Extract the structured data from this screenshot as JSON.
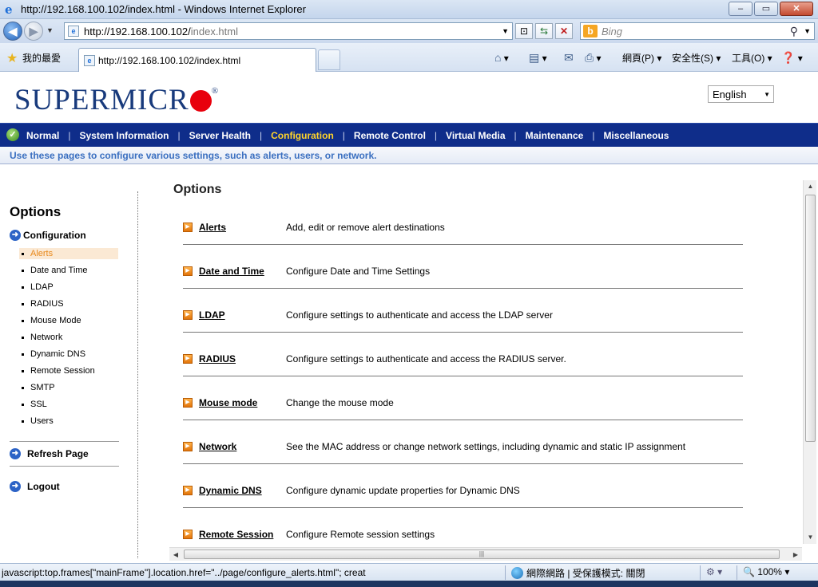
{
  "browser": {
    "title": "http://192.168.100.102/index.html - Windows Internet Explorer",
    "address_host": "http://192.168.100.102/",
    "address_path": "index.html",
    "search_placeholder": "Bing",
    "favorites_label": "我的最愛",
    "tab_title": "http://192.168.100.102/index.html",
    "commands": {
      "page": "網頁(P)",
      "safety": "安全性(S)",
      "tools": "工具(O)"
    },
    "window_buttons": {
      "minimize": "–",
      "maximize": "▭",
      "close": "✕"
    }
  },
  "header": {
    "logo_text": "SUPERMICR",
    "language": "English"
  },
  "nav": {
    "items": [
      {
        "label": "Normal"
      },
      {
        "label": "System Information"
      },
      {
        "label": "Server Health"
      },
      {
        "label": "Configuration",
        "active": true
      },
      {
        "label": "Remote Control"
      },
      {
        "label": "Virtual Media"
      },
      {
        "label": "Maintenance"
      },
      {
        "label": "Miscellaneous"
      }
    ],
    "subtitle": "Use these pages to configure various settings, such as alerts, users, or network."
  },
  "sidebar": {
    "title": "Options",
    "section": "Configuration",
    "items": [
      "Alerts",
      "Date and Time",
      "LDAP",
      "RADIUS",
      "Mouse Mode",
      "Network",
      "Dynamic DNS",
      "Remote Session",
      "SMTP",
      "SSL",
      "Users"
    ],
    "active_index": 0,
    "refresh": "Refresh Page",
    "logout": "Logout"
  },
  "main": {
    "title": "Options",
    "options": [
      {
        "name": "Alerts",
        "desc": "Add, edit or remove alert destinations"
      },
      {
        "name": "Date and Time",
        "desc": "Configure Date and Time Settings"
      },
      {
        "name": "LDAP",
        "desc": "Configure settings to authenticate and access the LDAP server"
      },
      {
        "name": "RADIUS",
        "desc": "Configure settings to authenticate and access the RADIUS server."
      },
      {
        "name": "Mouse mode",
        "desc": "Change the mouse mode"
      },
      {
        "name": "Network",
        "desc": "See the MAC address or change network settings, including dynamic and static IP assignment"
      },
      {
        "name": "Dynamic DNS",
        "desc": "Configure dynamic update properties for Dynamic DNS"
      },
      {
        "name": "Remote Session",
        "desc": "Configure Remote session settings"
      }
    ]
  },
  "status": {
    "text": "javascript:top.frames[\"mainFrame\"].location.href=\"../page/configure_alerts.html\"; creat",
    "zone": "網際網路 | 受保護模式: 關閉",
    "zoom": "100%"
  }
}
